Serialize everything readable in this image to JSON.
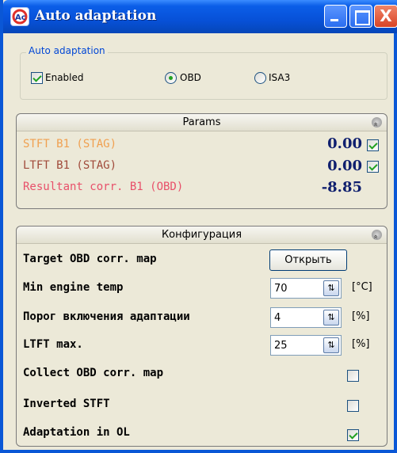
{
  "window": {
    "title": "Auto adaptation",
    "close_label": "X"
  },
  "adaptation_group": {
    "legend": "Auto adaptation",
    "enabled_label": "Enabled",
    "enabled_checked": true,
    "mode_options": [
      "OBD",
      "ISA3"
    ],
    "mode_selected": "OBD"
  },
  "params": {
    "header": "Params",
    "rows": [
      {
        "label": "STFT B1 (STAG)",
        "value": "0.00",
        "checked": true,
        "color": "#f0a050"
      },
      {
        "label": "LTFT B1 (STAG)",
        "value": "0.00",
        "checked": true,
        "color": "#a04a3a"
      },
      {
        "label": "Resultant corr. B1 (OBD)",
        "value": "-8.85",
        "color": "#e8506a"
      }
    ]
  },
  "config": {
    "header": "Конфигурация",
    "target_map_label": "Target OBD corr. map",
    "open_button": "Открыть",
    "min_temp_label": "Min engine temp",
    "min_temp_value": "70",
    "min_temp_unit": "[°C]",
    "threshold_label": "Порог включения адаптации",
    "threshold_value": "4",
    "threshold_unit": "[%]",
    "ltft_max_label": "LTFT max.",
    "ltft_max_value": "25",
    "ltft_max_unit": "[%]",
    "collect_label": "Collect OBD corr. map",
    "collect_checked": false,
    "inverted_label": "Inverted STFT",
    "inverted_checked": false,
    "adapt_ol_label": "Adaptation in OL",
    "adapt_ol_checked": true
  },
  "colors": {
    "title_bar": "#0751d8",
    "value_text": "#0f1f6e",
    "legend_text": "#0046d5"
  },
  "icons": {
    "app": "auto-adaptation-app-icon",
    "minimize": "minimize-icon",
    "maximize": "maximize-icon",
    "close": "close-icon",
    "collapse": "collapse-icon",
    "spin": "spin-arrows-icon"
  }
}
